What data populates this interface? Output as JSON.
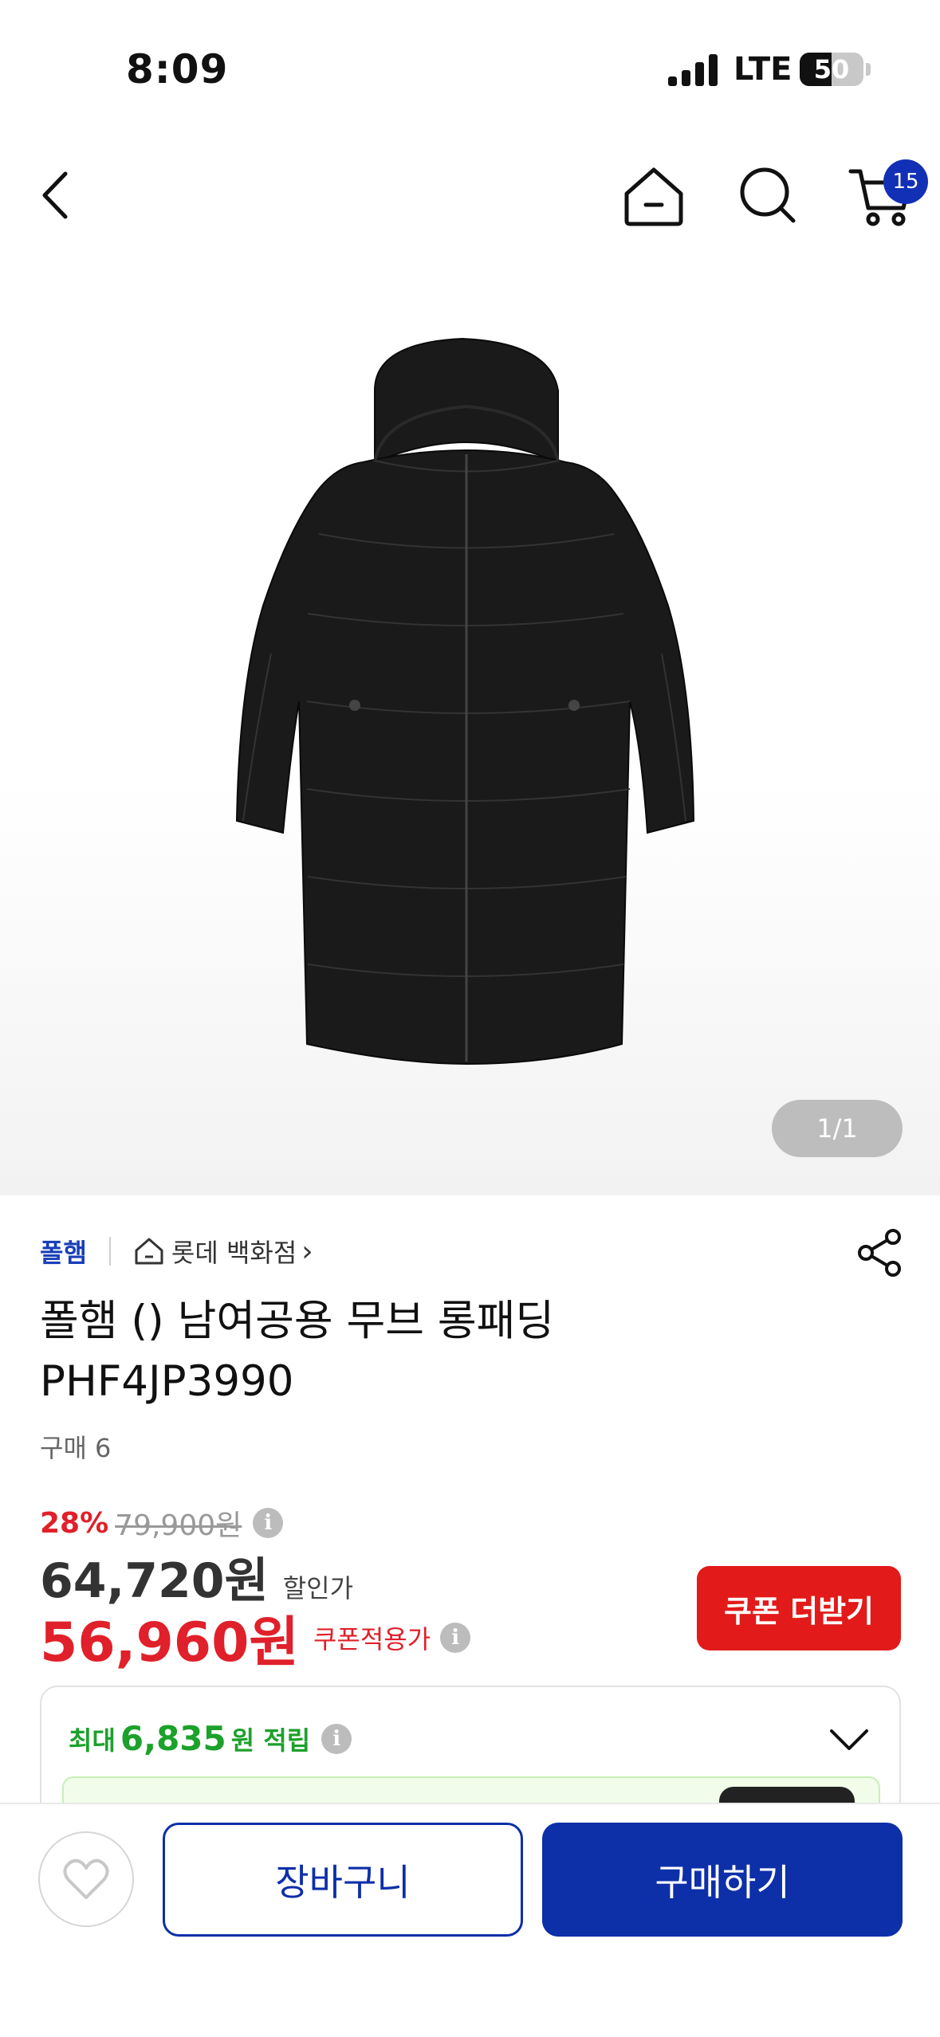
{
  "status_bar": {
    "time": "8:09",
    "network": "LTE",
    "battery_level": "50",
    "battery_fraction": 0.5,
    "signal_bars": 4
  },
  "nav": {
    "back_icon": "chevron-left-icon",
    "home_icon": "home-icon",
    "search_icon": "search-icon",
    "cart_icon": "cart-icon",
    "cart_count": "15"
  },
  "gallery": {
    "image_subject": "black-long-padded-jacket",
    "page_current": "1",
    "page_separator": "/",
    "page_total": "1"
  },
  "product": {
    "brand": "폴햄",
    "store_icon": "store-icon",
    "store": "롯데 백화점",
    "store_arrow": "›",
    "title_line1": "폴햄 () 남여공용 무브 롱패딩",
    "title_line2": "PHF4JP3990",
    "purchase_count": "구매 6"
  },
  "price": {
    "discount_rate": "28%",
    "original_price": "79,900원",
    "sale_price": "64,720원",
    "sale_label": "할인가",
    "coupon_price": "56,960원",
    "coupon_label": "쿠폰적용가",
    "coupon_button": "쿠폰 더받기",
    "info_glyph": "i",
    "colors": {
      "red": "#e0202a",
      "brand_blue": "#0d2fa8",
      "green": "#1ca12b"
    }
  },
  "points": {
    "prefix": "최대",
    "value": "6,835",
    "suffix": "원 적립"
  },
  "bottom_bar": {
    "wishlist_icon": "heart-icon",
    "cart_label": "장바구니",
    "buy_label": "구매하기"
  }
}
